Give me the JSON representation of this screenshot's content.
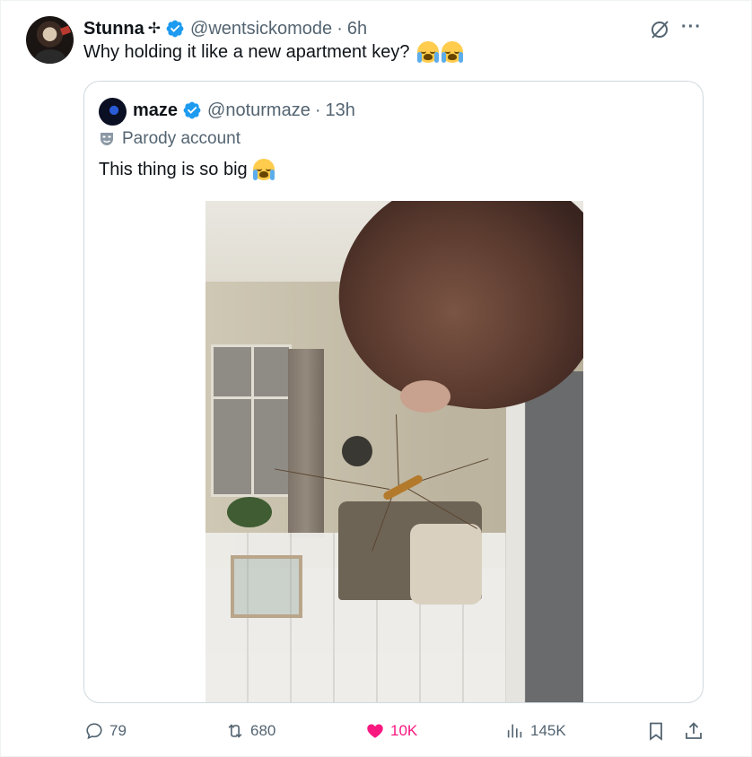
{
  "post": {
    "author_name": "Stunna",
    "author_emoji": "✢",
    "handle": "@wentsickomode",
    "separator": "·",
    "time": "6h",
    "text": "Why holding it like a new apartment key?"
  },
  "quote": {
    "author_name": "maze",
    "handle": "@noturmaze",
    "separator": "·",
    "time": "13h",
    "parody_label": "Parody account",
    "text": "This thing is so big"
  },
  "actions": {
    "replies": "79",
    "reposts": "680",
    "likes": "10K",
    "views": "145K"
  },
  "icons": {
    "menu": "···"
  },
  "colors": {
    "like_accent": "#f91880",
    "verified": "#1d9bf0",
    "secondary_text": "#536471"
  }
}
